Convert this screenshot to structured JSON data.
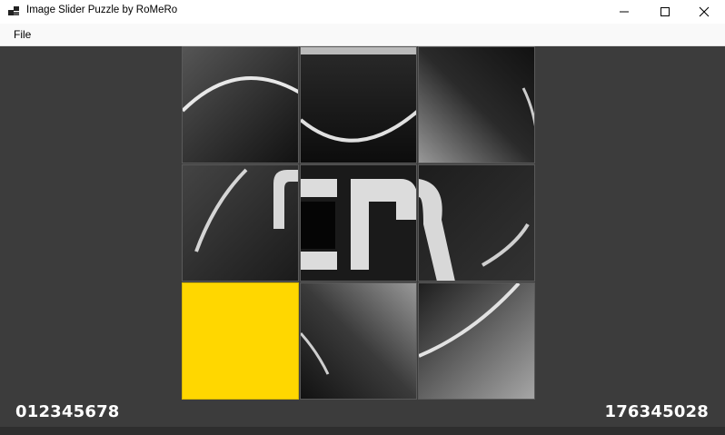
{
  "window": {
    "title": "Image Slider Puzzle by RoMeRo",
    "icon": "app-icon",
    "controls": [
      "minimize-icon",
      "maximize-icon",
      "close-icon"
    ]
  },
  "menu": {
    "items": [
      {
        "label": "File"
      }
    ]
  },
  "puzzle": {
    "blank_color": "#ffd700",
    "tiles": [
      {
        "piece": 1
      },
      {
        "piece": 7
      },
      {
        "piece": 6
      },
      {
        "piece": 3
      },
      {
        "piece": 4
      },
      {
        "piece": 5
      },
      {
        "piece": 0
      },
      {
        "piece": 2
      },
      {
        "piece": 8
      }
    ]
  },
  "status": {
    "goal_sequence": "012345678",
    "current_sequence": "176345028"
  }
}
